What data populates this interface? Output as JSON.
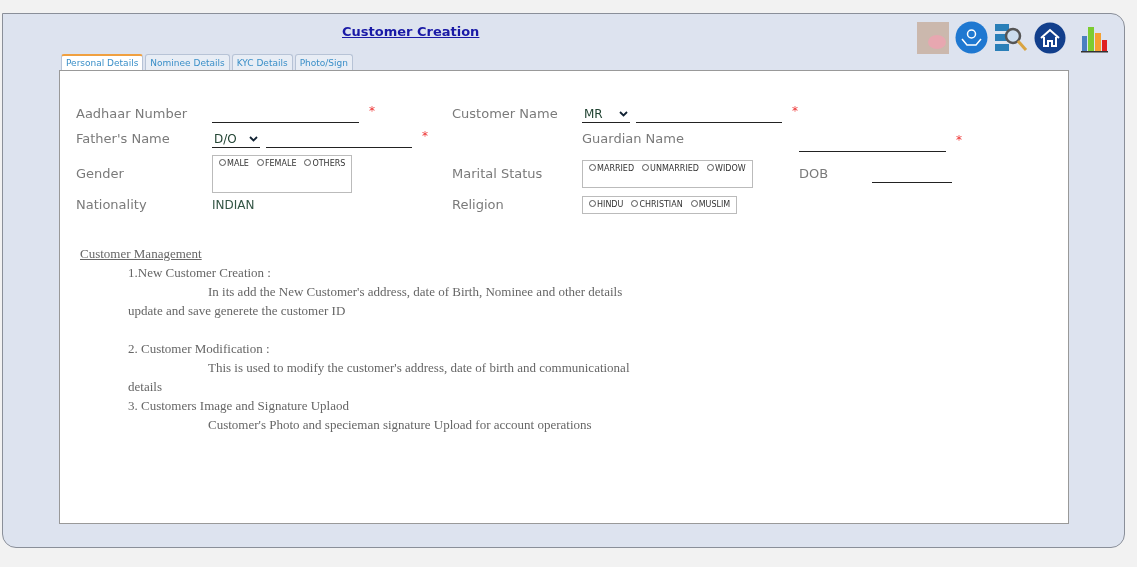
{
  "title": "Customer Creation",
  "tabs": [
    {
      "label": "Personal Details",
      "selected": true
    },
    {
      "label": "Nominee Details",
      "selected": false
    },
    {
      "label": "KYC Details",
      "selected": false
    },
    {
      "label": "Photo/Sign",
      "selected": false
    }
  ],
  "form": {
    "aadhaar": {
      "label": "Aadhaar Number",
      "required_mark": "*"
    },
    "customer_name": {
      "label": "Customer Name",
      "title": "MR",
      "required_mark": "*"
    },
    "fathers_name": {
      "label": "Father's Name",
      "relation": "D/O",
      "required_mark": "*"
    },
    "guardian_name": {
      "label": "Guardian Name",
      "required_mark": "*"
    },
    "gender": {
      "label": "Gender",
      "options": [
        {
          "label": "MALE",
          "selected": false
        },
        {
          "label": "FEMALE",
          "selected": false
        },
        {
          "label": "OTHERS",
          "selected": false
        }
      ]
    },
    "marital_status": {
      "label": "Marital Status",
      "options": [
        {
          "label": "MARRIED",
          "selected": false
        },
        {
          "label": "UNMARRIED",
          "selected": false
        },
        {
          "label": "WIDOW",
          "selected": false
        }
      ]
    },
    "dob": {
      "label": "DOB"
    },
    "nationality": {
      "label": "Nationality",
      "value": "INDIAN"
    },
    "religion": {
      "label": "Religion",
      "options": [
        {
          "label": "HINDU",
          "selected": false
        },
        {
          "label": "CHRISTIAN",
          "selected": false
        },
        {
          "label": "MUSLIM",
          "selected": false
        }
      ]
    }
  },
  "help": {
    "heading": "Customer Management ",
    "sections": [
      {
        "title": "1.New Customer Creation :",
        "body": "In its  add the New Customer's address, date of Birth, Nominee and other details update and save generete the customer ID"
      },
      {
        "title": "2. Customer Modification  :",
        "body": "This is used to  modify the customer's address, date of birth and communicational details"
      },
      {
        "title": "3. Customers Image and Signature Uplaod",
        "body": "Customer's Photo and specieman signature Upload for account operations"
      }
    ]
  }
}
